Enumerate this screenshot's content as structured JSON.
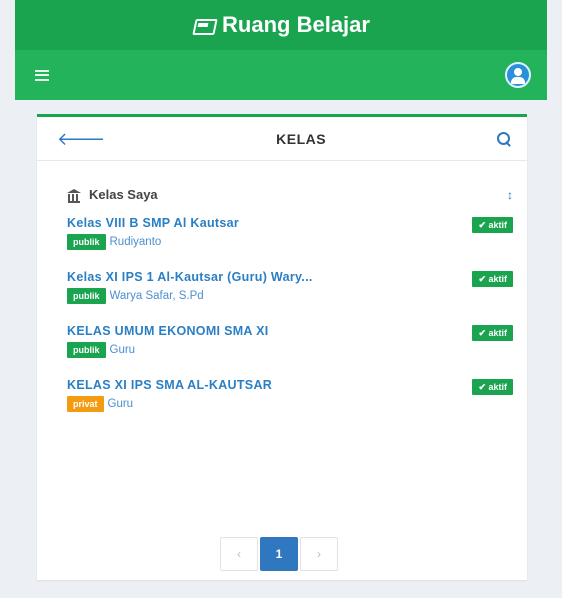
{
  "app": {
    "title": "Ruang Belajar"
  },
  "card": {
    "title": "KELAS",
    "section_title": "Kelas Saya"
  },
  "classes": [
    {
      "name": "Kelas VIII B SMP Al Kautsar",
      "visibility": "publik",
      "teacher": "Rudiyanto",
      "status": "✔ aktif"
    },
    {
      "name": "Kelas XI IPS 1 Al-Kautsar (Guru) Wary...",
      "visibility": "publik",
      "teacher": "Warya Safar, S.Pd",
      "status": "✔ aktif"
    },
    {
      "name": "KELAS UMUM EKONOMI SMA XI",
      "visibility": "publik",
      "teacher": "Guru",
      "status": "✔ aktif"
    },
    {
      "name": "KELAS XI IPS SMA AL-KAUTSAR",
      "visibility": "privat",
      "teacher": "Guru",
      "status": "✔ aktif"
    }
  ],
  "pagination": {
    "prev": "‹",
    "current": "1",
    "next": "›"
  },
  "colors": {
    "primary": "#1aa44f",
    "accent": "#2f78c0",
    "warning": "#f39c12"
  },
  "icons": [
    "book-icon",
    "menu-icon",
    "user-icon",
    "back-arrow-icon",
    "search-icon",
    "bank-icon",
    "sort-icon"
  ]
}
